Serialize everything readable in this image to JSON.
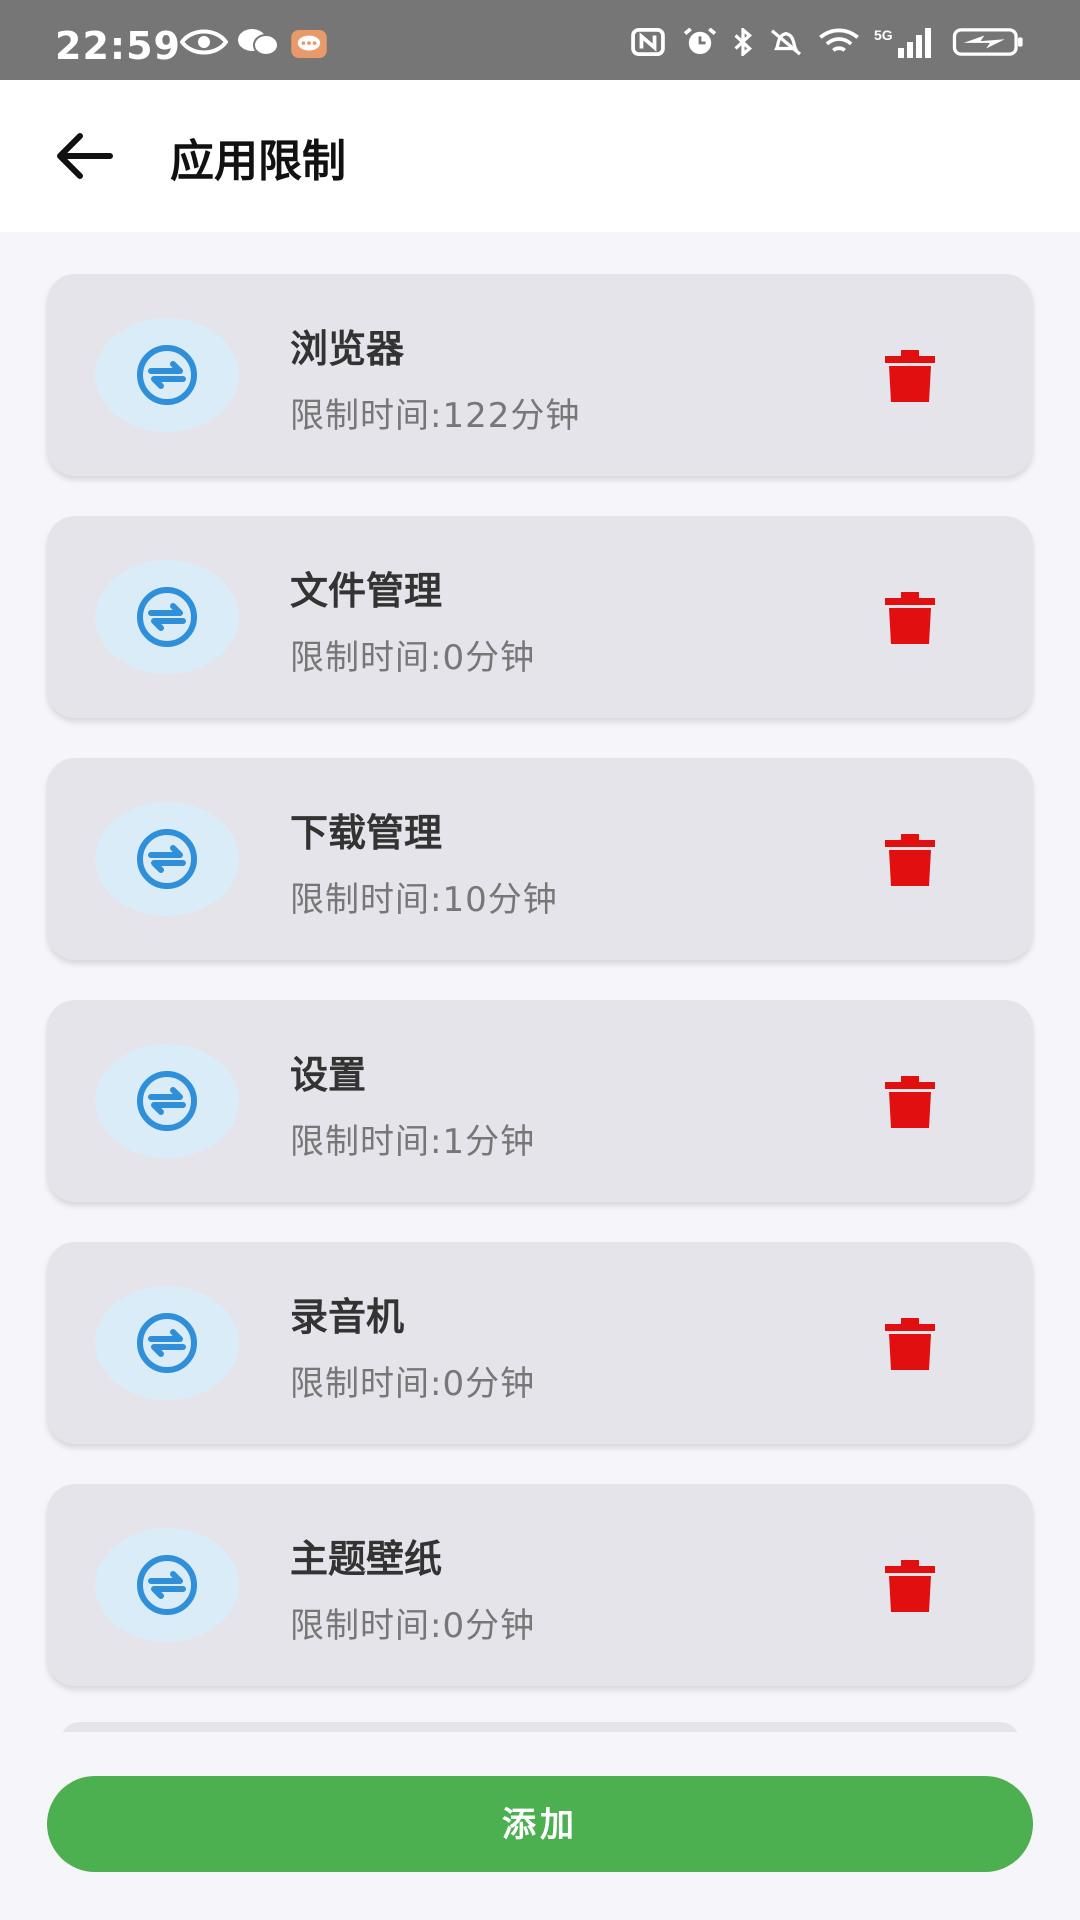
{
  "status_bar": {
    "time": "22:59",
    "icons": [
      "eye-icon",
      "wechat-icon",
      "message-icon",
      "nfc-icon",
      "alarm-icon",
      "bluetooth-icon",
      "mute-icon",
      "wifi-icon",
      "5g-signal-icon",
      "battery-charging-icon"
    ],
    "network": "5G"
  },
  "header": {
    "title": "应用限制",
    "back_icon": "arrow-left-icon"
  },
  "apps": [
    {
      "name": "浏览器",
      "limit": "限制时间:122分钟"
    },
    {
      "name": "文件管理",
      "limit": "限制时间:0分钟"
    },
    {
      "name": "下载管理",
      "limit": "限制时间:10分钟"
    },
    {
      "name": "设置",
      "limit": "限制时间:1分钟"
    },
    {
      "name": "录音机",
      "limit": "限制时间:0分钟"
    },
    {
      "name": "主题壁纸",
      "limit": "限制时间:0分钟"
    }
  ],
  "add_button": {
    "label": "添加"
  },
  "colors": {
    "status_bar": "#767676",
    "card": "#e4e4ea",
    "icon_blue": "#2f8fd8",
    "delete_red": "#e10f0f",
    "add_green": "#4caf50"
  }
}
